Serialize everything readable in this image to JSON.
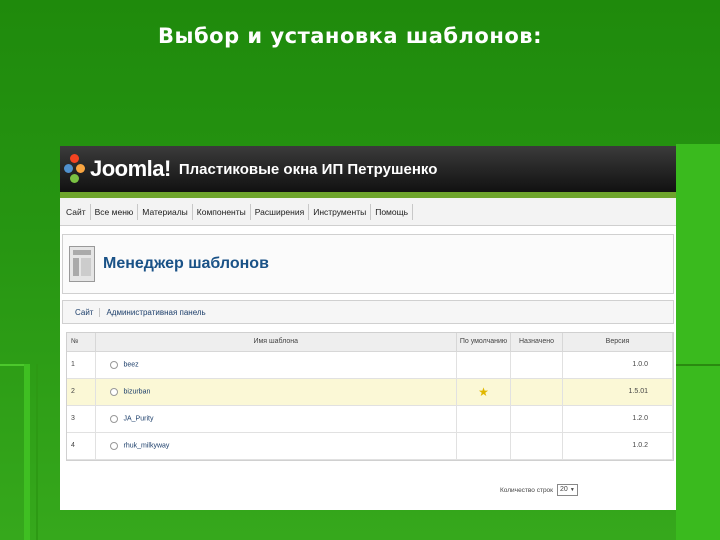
{
  "slide": {
    "title": "Выбор и установка шаблонов:"
  },
  "header": {
    "logo_text": "Joomla!",
    "site_name": "Пластиковые окна ИП Петрушенко"
  },
  "menu": {
    "items": [
      "Сайт",
      "Все меню",
      "Материалы",
      "Компоненты",
      "Расширения",
      "Инструменты",
      "Помощь"
    ]
  },
  "toolbar": {
    "title": "Менеджер шаблонов"
  },
  "tabs": [
    "Сайт",
    "Административная панель"
  ],
  "table": {
    "headers": {
      "no": "№",
      "name": "Имя шаблона",
      "default": "По умолчанию",
      "assigned": "Назначено",
      "version": "Версия"
    },
    "rows": [
      {
        "no": "1",
        "name": "beez",
        "is_default": false,
        "version": "1.0.0"
      },
      {
        "no": "2",
        "name": "bizurban",
        "is_default": true,
        "version": "1.5.01"
      },
      {
        "no": "3",
        "name": "JA_Purity",
        "is_default": false,
        "version": "1.2.0"
      },
      {
        "no": "4",
        "name": "rhuk_milkyway",
        "is_default": false,
        "version": "1.0.2"
      }
    ]
  },
  "footer": {
    "rows_label": "Количество строк",
    "rows_value": "20"
  },
  "colors": {
    "background": "#279612",
    "header": "#111111",
    "accent_green": "#6ea42c",
    "link": "#1d3f6b",
    "highlight_row": "#fbf8d6"
  },
  "icons": {
    "default_star": "star-icon"
  }
}
